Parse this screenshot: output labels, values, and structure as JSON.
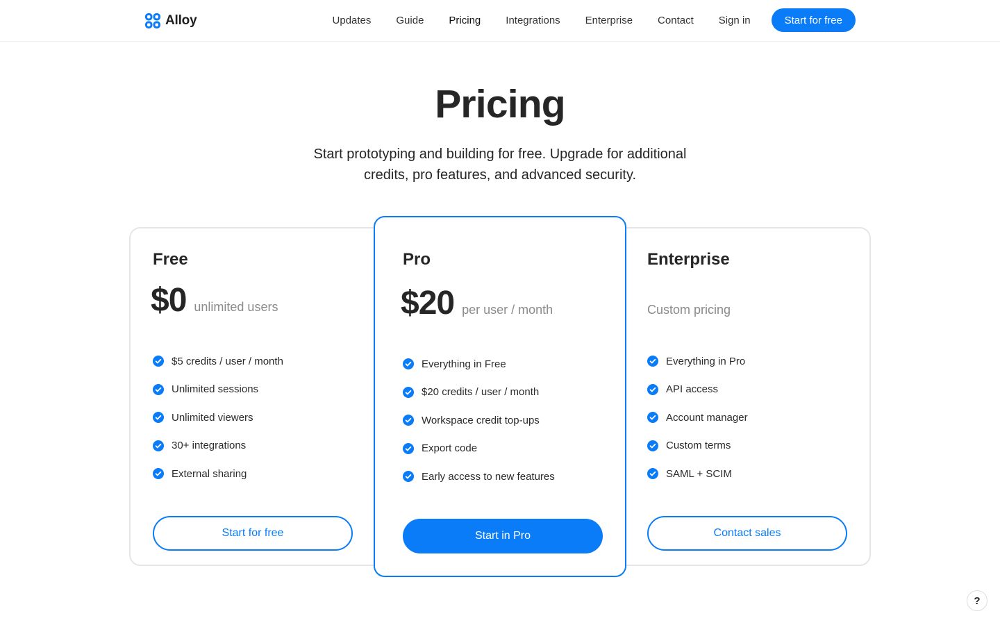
{
  "brand": {
    "name": "Alloy",
    "logo_icon": "four-dot-logo-icon",
    "accent_color": "#0a7cf8"
  },
  "nav": {
    "links": [
      "Updates",
      "Guide",
      "Pricing",
      "Integrations",
      "Enterprise",
      "Contact",
      "Sign in"
    ],
    "active": "Pricing",
    "cta_label": "Start for free"
  },
  "hero": {
    "title": "Pricing",
    "subtitle": "Start prototyping and building for free. Upgrade for additional credits, pro features, and advanced security."
  },
  "plans": [
    {
      "name": "Free",
      "price": "$0",
      "price_note": "unlimited users",
      "features": [
        "$5 credits / user / month",
        "Unlimited sessions",
        "Unlimited viewers",
        "30+ integrations",
        "External sharing"
      ],
      "cta_label": "Start for free"
    },
    {
      "name": "Pro",
      "price": "$20",
      "price_note": "per user / month",
      "features": [
        "Everything in Free",
        "$20 credits / user / month",
        "Workspace credit top-ups",
        "Export code",
        "Early access to new features"
      ],
      "cta_label": "Start in Pro",
      "highlighted": true
    },
    {
      "name": "Enterprise",
      "price_note": "Custom pricing",
      "features": [
        "Everything in Pro",
        "API access",
        "Account manager",
        "Custom terms",
        "SAML + SCIM"
      ],
      "cta_label": "Contact sales"
    }
  ],
  "feature_icon": "check-circle-icon",
  "help": {
    "label": "?",
    "icon": "help-icon"
  }
}
